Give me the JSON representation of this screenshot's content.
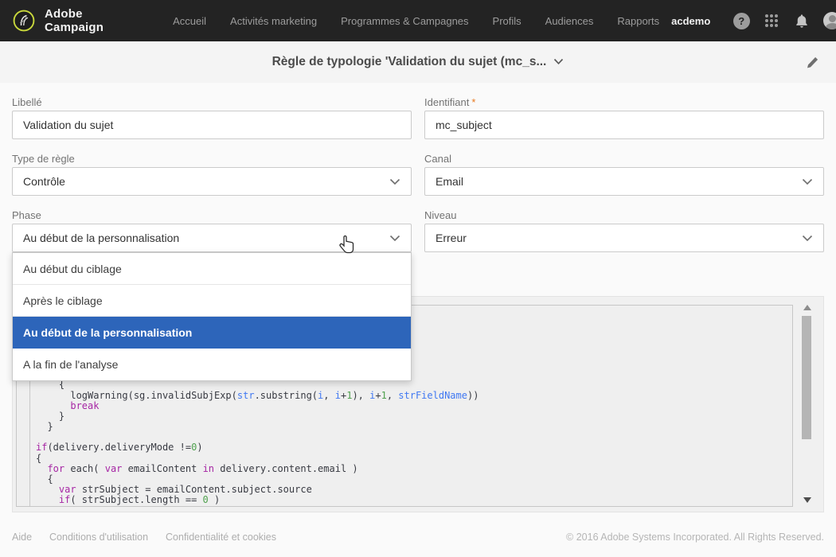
{
  "navbar": {
    "brand": "Adobe Campaign",
    "items": [
      "Accueil",
      "Activités marketing",
      "Programmes & Campagnes",
      "Profils",
      "Audiences",
      "Rapports"
    ],
    "account": "acdemo",
    "icons": [
      {
        "name": "help",
        "glyph": "?"
      },
      {
        "name": "apps-grid"
      },
      {
        "name": "notifications"
      },
      {
        "name": "user"
      }
    ]
  },
  "header": {
    "title": "Règle de typologie 'Validation du sujet (mc_s..."
  },
  "form": {
    "fields": [
      {
        "label": "Libellé",
        "value": "Validation du sujet",
        "type": "text"
      },
      {
        "label": "Identifiant",
        "required": "*",
        "value": "mc_subject",
        "type": "text"
      },
      {
        "label": "Type de règle",
        "value": "Contrôle",
        "type": "select"
      },
      {
        "label": "Canal",
        "value": "Email",
        "type": "select"
      },
      {
        "label": "Phase",
        "value": "Au début de la personnalisation",
        "type": "select",
        "open": true
      },
      {
        "label": "Niveau",
        "value": "Erreur",
        "type": "select"
      }
    ]
  },
  "dropdown": {
    "options": [
      "Au début du ciblage",
      "Après le ciblage",
      "Au début de la personnalisation",
      "A la fin de l'analyse"
    ],
    "selected_index": 2,
    "selected_color": "#2d65ba"
  },
  "code_editor": {
    "language": "javascript",
    "hidden_lines_above": 7,
    "syntax_colors": {
      "keyword": "#a626a4",
      "number": "#50a14f",
      "variable": "#4078f2",
      "default": "#383a42"
    },
    "lines": [
      [
        [
          "d",
          "    {"
        ]
      ],
      [
        [
          "d",
          "      logWarning(sg.invalidSubjExp("
        ],
        [
          "v",
          "str"
        ],
        [
          "d",
          ".substring("
        ],
        [
          "v",
          "i"
        ],
        [
          "d",
          ", "
        ],
        [
          "v",
          "i"
        ],
        [
          "d",
          "+"
        ],
        [
          "n",
          "1"
        ],
        [
          "d",
          "), "
        ],
        [
          "v",
          "i"
        ],
        [
          "d",
          "+"
        ],
        [
          "n",
          "1"
        ],
        [
          "d",
          ", "
        ],
        [
          "v",
          "strFieldName"
        ],
        [
          "d",
          "))"
        ]
      ],
      [
        [
          "d",
          "      "
        ],
        [
          "k",
          "break"
        ]
      ],
      [
        [
          "d",
          "    }"
        ]
      ],
      [
        [
          "d",
          "  }"
        ]
      ],
      [],
      [
        [
          "k",
          "if"
        ],
        [
          "d",
          "(delivery.deliveryMode !="
        ],
        [
          "n",
          "0"
        ],
        [
          "d",
          ")"
        ]
      ],
      [
        [
          "d",
          "{"
        ]
      ],
      [
        [
          "d",
          "  "
        ],
        [
          "k",
          "for"
        ],
        [
          "d",
          " each( "
        ],
        [
          "k",
          "var"
        ],
        [
          "d",
          " emailContent "
        ],
        [
          "k",
          "in"
        ],
        [
          "d",
          " delivery.content.email )"
        ]
      ],
      [
        [
          "d",
          "  {"
        ]
      ],
      [
        [
          "d",
          "    "
        ],
        [
          "k",
          "var"
        ],
        [
          "d",
          " strSubject = emailContent.subject.source"
        ]
      ],
      [
        [
          "d",
          "    "
        ],
        [
          "k",
          "if"
        ],
        [
          "d",
          "( strSubject.length == "
        ],
        [
          "n",
          "0"
        ],
        [
          "d",
          " )"
        ]
      ],
      [
        [
          "d",
          "    {"
        ]
      ]
    ]
  },
  "footer": {
    "links": [
      "Aide",
      "Conditions d'utilisation",
      "Confidentialité et cookies"
    ],
    "copyright": "© 2016 Adobe Systems Incorporated. All Rights Reserved."
  },
  "colors": {
    "navbar_bg": "#232323",
    "header_bg": "#f4f4f4",
    "page_bg": "#fafafa",
    "accent_blue": "#2d65ba",
    "required_asterisk": "#e87a21"
  }
}
